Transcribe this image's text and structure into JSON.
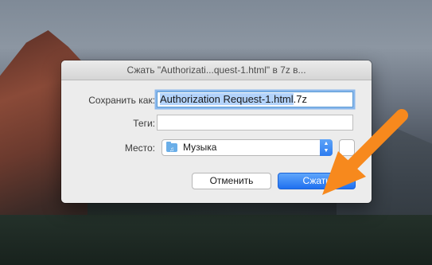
{
  "dialog": {
    "title": "Сжать \"Authorizati...quest-1.html\" в 7z в...",
    "save_as_label": "Сохранить как:",
    "save_as_selected": "Authorization Request-1.html",
    "save_as_suffix": ".7z",
    "tags_label": "Теги:",
    "tags_value": "",
    "location_label": "Место:",
    "location_value": "Музыка",
    "cancel_label": "Отменить",
    "compress_label": "Сжать"
  },
  "icons": {
    "folder": "music-folder-icon",
    "stepper": "chevron-up-down-icon",
    "expand": "expand-icon",
    "arrow": "orange-arrow-icon"
  },
  "colors": {
    "accent": "#2c7bf0",
    "arrow": "#f7891d"
  }
}
